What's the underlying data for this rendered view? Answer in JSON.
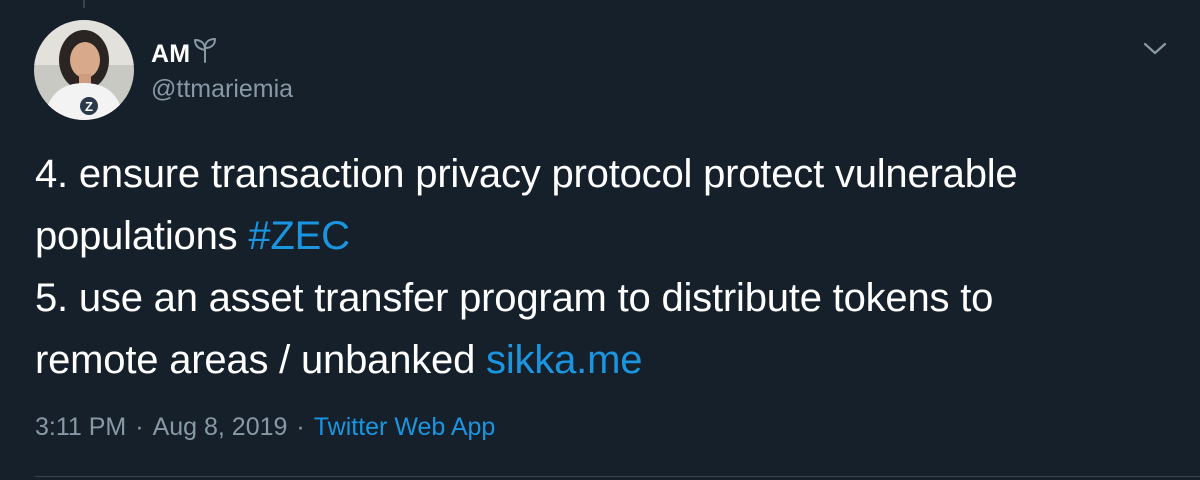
{
  "tweet": {
    "author": {
      "display_name": "AM",
      "handle": "@ttmariemia",
      "avatar_icon": "user-avatar-photo",
      "badge_icon": "sprout-icon"
    },
    "menu_icon": "chevron-down-icon",
    "lines": [
      {
        "text": "4. ensure transaction privacy protocol protect vulnerable"
      },
      {
        "text": "populations ",
        "link": "#ZEC"
      },
      {
        "text": "5. use an asset transfer program to distribute tokens to"
      },
      {
        "text": "remote areas / unbanked ",
        "link": "sikka.me"
      }
    ],
    "time": "3:11 PM",
    "separator": "·",
    "date": "Aug 8, 2019",
    "source": "Twitter Web App"
  },
  "colors": {
    "background": "#15202b",
    "text": "#ffffff",
    "secondary_text": "#8899a6",
    "link": "#1b95e0",
    "border": "#38444d"
  }
}
